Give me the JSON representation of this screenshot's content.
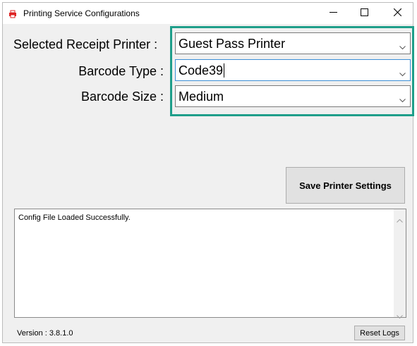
{
  "window": {
    "title": "Printing Service Configurations"
  },
  "form": {
    "printer_label": "Selected Receipt Printer :",
    "printer_value": "Guest Pass Printer",
    "barcode_type_label": "Barcode Type :",
    "barcode_type_value": "Code39",
    "barcode_size_label": "Barcode Size :",
    "barcode_size_value": "Medium"
  },
  "actions": {
    "save_label": "Save Printer Settings",
    "reset_logs_label": "Reset Logs"
  },
  "log": {
    "text": "Config File Loaded Successfully."
  },
  "footer": {
    "version": "Version : 3.8.1.0"
  },
  "colors": {
    "highlight_border": "#1f9e8a",
    "window_background": "#f0f0f0",
    "focus_border": "#3c8fd6"
  },
  "icons": {
    "app": "printer-icon",
    "minimize": "minimize-icon",
    "maximize": "maximize-icon",
    "close": "close-icon",
    "dropdown": "chevron-down-icon"
  }
}
